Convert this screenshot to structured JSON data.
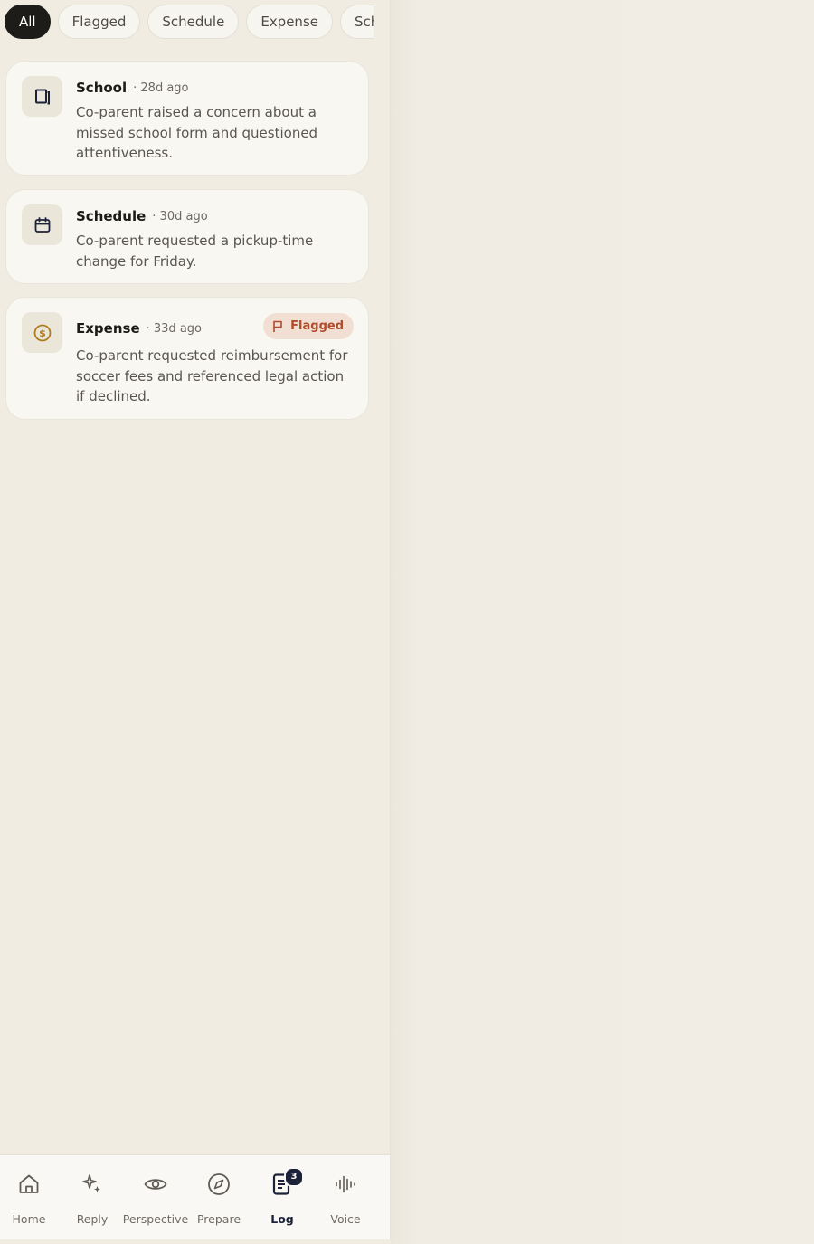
{
  "filters": [
    {
      "label": "All",
      "active": true
    },
    {
      "label": "Flagged",
      "active": false
    },
    {
      "label": "Schedule",
      "active": false
    },
    {
      "label": "Expense",
      "active": false
    },
    {
      "label": "Sch",
      "active": false
    }
  ],
  "entries": [
    {
      "category": "School",
      "age": "· 28d ago",
      "icon": "book-icon",
      "text": "Co-parent raised a concern about a missed school form and questioned attentiveness."
    },
    {
      "category": "Schedule",
      "age": "· 30d ago",
      "icon": "calendar-icon",
      "text": "Co-parent requested a pickup-time change for Friday."
    },
    {
      "category": "Expense",
      "age": "· 33d ago",
      "icon": "dollar-coin-icon",
      "flag_label": "Flagged",
      "text": "Co-parent requested reimbursement for soccer fees and referenced legal action if declined."
    }
  ],
  "nav": {
    "items": [
      {
        "label": "Home",
        "icon": "home-icon"
      },
      {
        "label": "Reply",
        "icon": "sparkle-icon"
      },
      {
        "label": "Perspective",
        "icon": "eye-icon"
      },
      {
        "label": "Prepare",
        "icon": "compass-icon"
      },
      {
        "label": "Log",
        "icon": "document-icon",
        "active": true,
        "badge": "3"
      },
      {
        "label": "Voice",
        "icon": "waveform-icon"
      }
    ]
  },
  "colors": {
    "background": "#f0ece2",
    "card": "#f8f7f2",
    "active_chip": "#1e1c19",
    "flag_bg": "#f2dfd4",
    "flag_text": "#b04b2c",
    "nav_active": "#1c2238",
    "expense_icon": "#b07a1e"
  }
}
